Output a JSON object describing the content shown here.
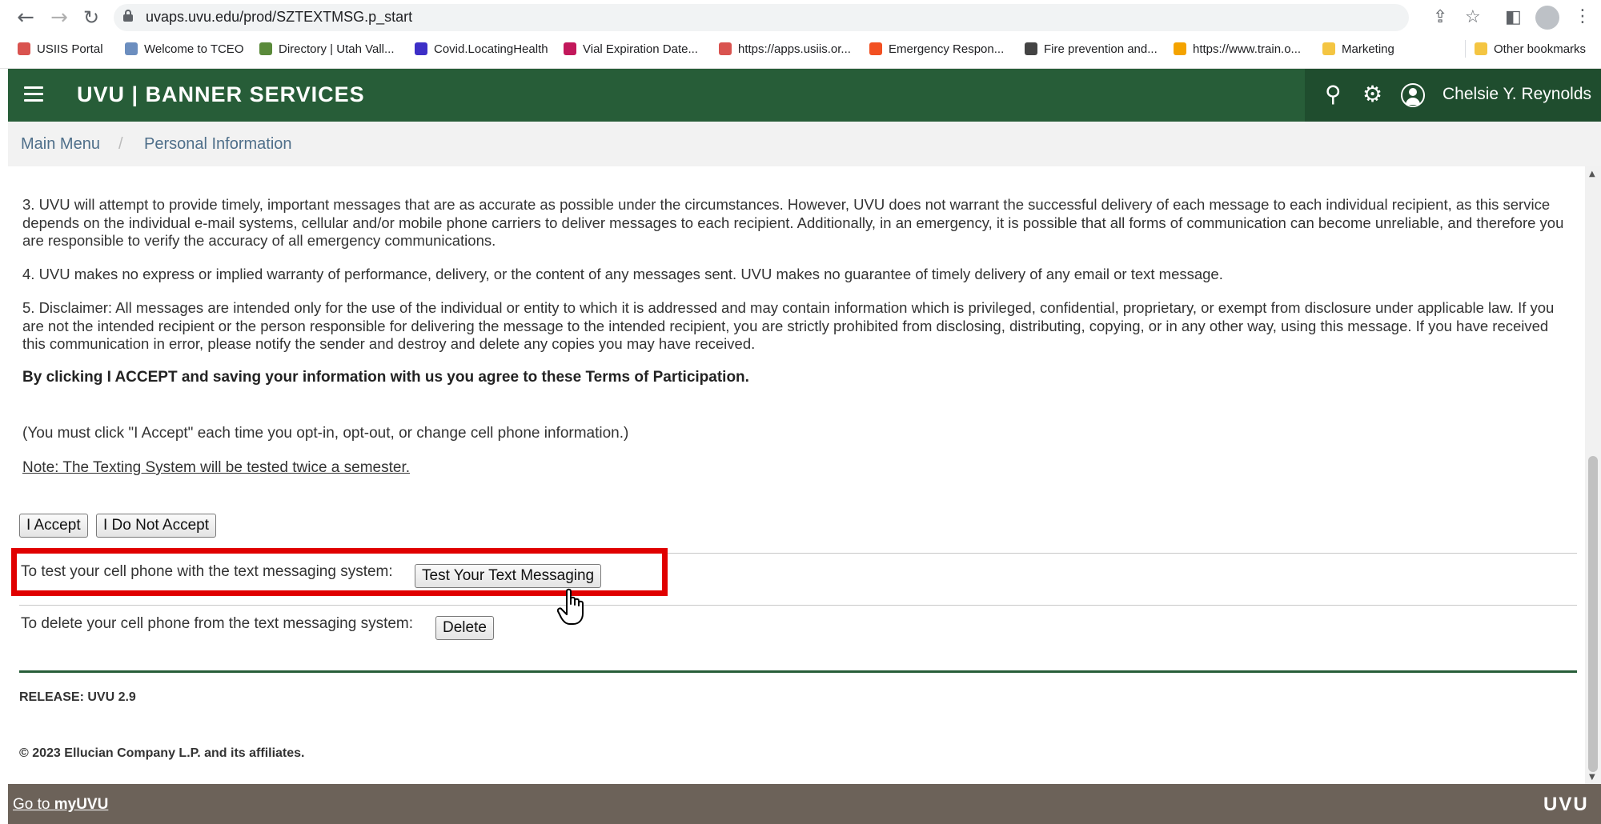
{
  "browser": {
    "url": "uvaps.uvu.edu/prod/SZTEXTMSG.p_start",
    "icons": [
      "back-icon",
      "forward-icon",
      "reload-icon",
      "lock-icon",
      "share-icon",
      "star-icon",
      "sidepanel-icon",
      "profile-icon",
      "menu-icon"
    ],
    "bookmarks": [
      {
        "label": "USIIS Portal",
        "color": "#d9534f"
      },
      {
        "label": "Welcome to TCEO",
        "color": "#6c8ebf"
      },
      {
        "label": "Directory | Utah Vall...",
        "color": "#5a8a3a"
      },
      {
        "label": "Covid.LocatingHealth",
        "color": "#3d2fc7"
      },
      {
        "label": "Vial Expiration Date...",
        "color": "#c2185b"
      },
      {
        "label": "https://apps.usiis.or...",
        "color": "#d9534f"
      },
      {
        "label": "Emergency Respon...",
        "color": "#f25022"
      },
      {
        "label": "Fire prevention and...",
        "color": "#444444"
      },
      {
        "label": "https://www.train.o...",
        "color": "#f4a300"
      },
      {
        "label": "Marketing",
        "color": "#f4c542"
      }
    ],
    "other_bookmarks": "Other bookmarks"
  },
  "header": {
    "title": "UVU | BANNER SERVICES",
    "user_name": "Chelsie Y. Reynolds",
    "brand_color": "#275d38"
  },
  "breadcrumb": {
    "items": [
      "Main Menu",
      "Personal Information"
    ],
    "separator": "/"
  },
  "content": {
    "para3": "3. UVU will attempt to provide timely, important messages that are as accurate as possible under the circumstances. However, UVU does not warrant the successful delivery of each message to each individual recipient, as this service depends on the individual e-mail systems, cellular and/or mobile phone carriers to deliver messages to each recipient. Additionally, in an emergency, it is possible that all forms of communication can become unreliable, and therefore you are responsible to verify the accuracy of all emergency communications.",
    "para4": "4. UVU makes no express or implied warranty of performance, delivery, or the content of any messages sent. UVU makes no guarantee of timely delivery of any email or text message.",
    "para5": "5. Disclaimer: All messages are intended only for the use of the individual or entity to which it is addressed and may contain information which is privileged, confidential, proprietary, or exempt from disclosure under applicable law. If you are not the intended recipient or the person responsible for delivering the message to the intended recipient, you are strictly prohibited from disclosing, distributing, copying, or in any other way, using this message. If you have received this communication in error, please notify the sender and destroy and delete any copies you may have received.",
    "agree_text": "By clicking I ACCEPT and saving your information with us you agree to these Terms of Participation.",
    "accept_note": "(You must click \"I Accept\" each time you opt-in, opt-out, or change cell phone information.)",
    "test_note": "Note: The Texting System will be tested twice a semester.",
    "accept_button": "I Accept",
    "decline_button": "I Do Not Accept",
    "test_label": "To test your cell phone with the text messaging system:",
    "test_button": "Test Your Text Messaging",
    "delete_label": "To delete your cell phone from the text messaging system:",
    "delete_button": "Delete",
    "release": "RELEASE: UVU 2.9",
    "copyright": "© 2023 Ellucian Company L.P. and its affiliates."
  },
  "footer": {
    "link_prefix": "Go to ",
    "link_bold": "myUVU",
    "logo": "UVU"
  },
  "highlight_color": "#e00000"
}
